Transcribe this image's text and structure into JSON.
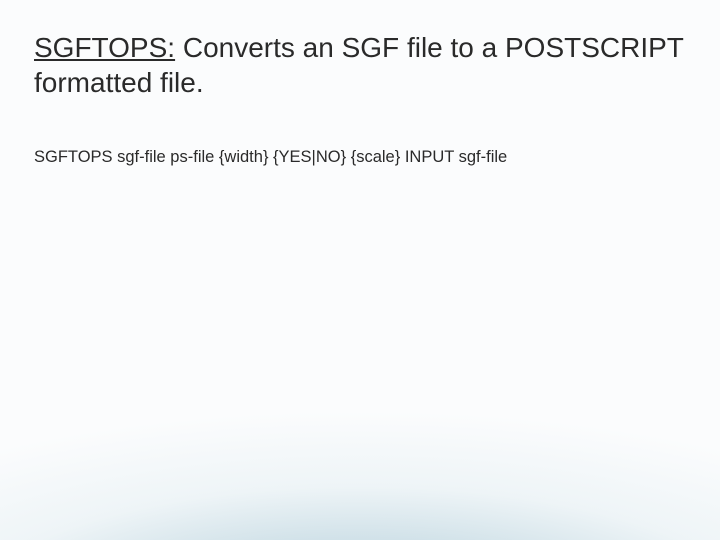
{
  "title": {
    "cmd": "SGFTOPS:",
    "rest": " Converts an SGF file to a POSTSCRIPT formatted file."
  },
  "usage": "SGFTOPS sgf-file ps-file {width} {YES|NO} {scale} INPUT sgf-file"
}
